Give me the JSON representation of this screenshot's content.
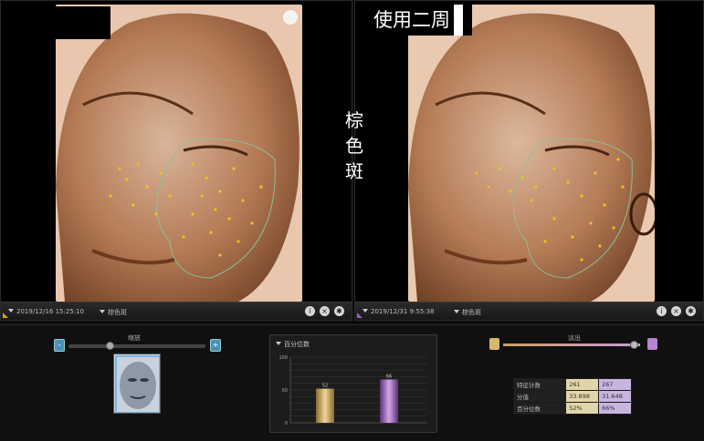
{
  "left_panel": {
    "date": "2019/12/16 15:25:10",
    "mode": "棕色斑"
  },
  "right_panel": {
    "title": "使用二周",
    "date": "2019/12/31 9:55:38",
    "mode": "棕色斑"
  },
  "side_label": [
    "棕",
    "色",
    "斑"
  ],
  "zoom": {
    "label": "缩放",
    "minus_label": "-",
    "plus_label": "+",
    "level": 0.3
  },
  "chart": {
    "label": "百分位数"
  },
  "compare": {
    "label": "淡出",
    "level": 0.95
  },
  "stats": {
    "rows": [
      {
        "label": "特征计数",
        "a": "261",
        "b": "267"
      },
      {
        "label": "分值",
        "a": "33.898",
        "b": "31.648"
      },
      {
        "label": "百分位数",
        "a": "52%",
        "b": "66%"
      }
    ]
  },
  "colors": {
    "accent_left": "#c8a400",
    "accent_right": "#9a4fb5",
    "bar_left": "#d8b66a",
    "bar_right": "#a874bf"
  },
  "chart_data": {
    "type": "bar",
    "title": "百分位数",
    "categories": [
      "",
      ""
    ],
    "values": [
      52,
      66
    ],
    "data_labels": [
      "52",
      "66"
    ],
    "ylim": [
      0,
      100
    ],
    "yticks": [
      "0",
      "50",
      "100"
    ],
    "grid": true
  }
}
